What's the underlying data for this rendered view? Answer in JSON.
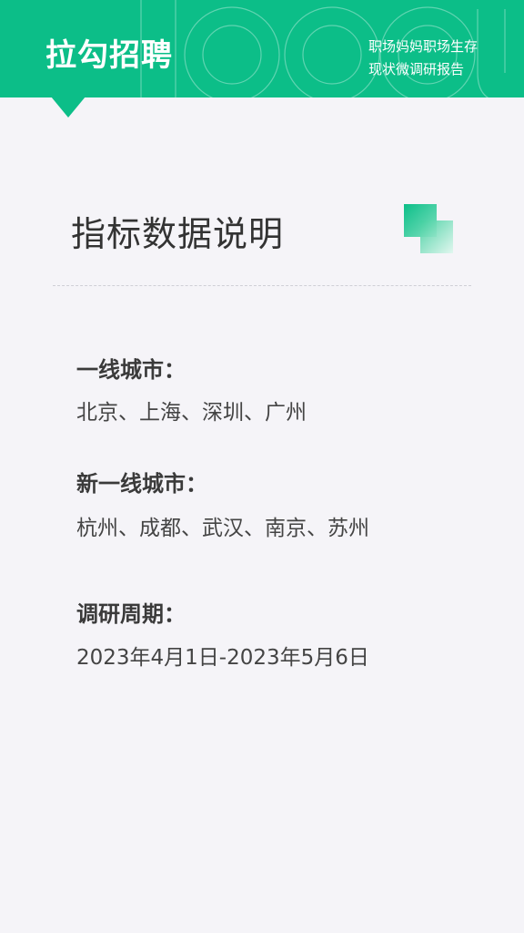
{
  "header": {
    "brand": "拉勾招聘",
    "subtitle_line1": "职场妈妈职场生存",
    "subtitle_line2": "现状微调研报告",
    "accent_color": "#0cbe88"
  },
  "section": {
    "title": "指标数据说明"
  },
  "items": [
    {
      "label": "一线城市：",
      "value": "北京、上海、深圳、广州"
    },
    {
      "label": "新一线城市：",
      "value": "杭州、成都、武汉、南京、苏州"
    },
    {
      "label": "调研周期：",
      "value": "2023年4月1日-2023年5月6日"
    }
  ]
}
